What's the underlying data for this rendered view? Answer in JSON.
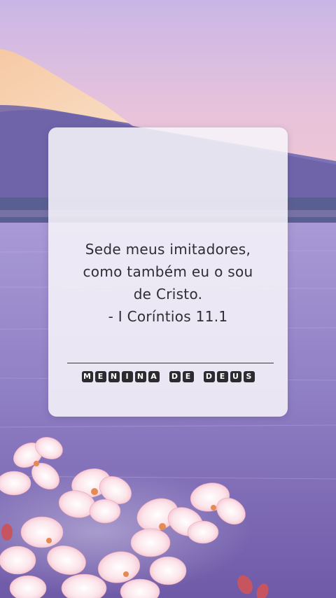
{
  "quote": {
    "lines": [
      "Sede meus imitadores,",
      "como também eu o sou",
      "de Cristo.",
      "- I Coríntios 11.1"
    ]
  },
  "brand": {
    "label": "MENINA DE DEUS",
    "words": [
      "MENINA",
      "DE",
      "DEUS"
    ]
  }
}
